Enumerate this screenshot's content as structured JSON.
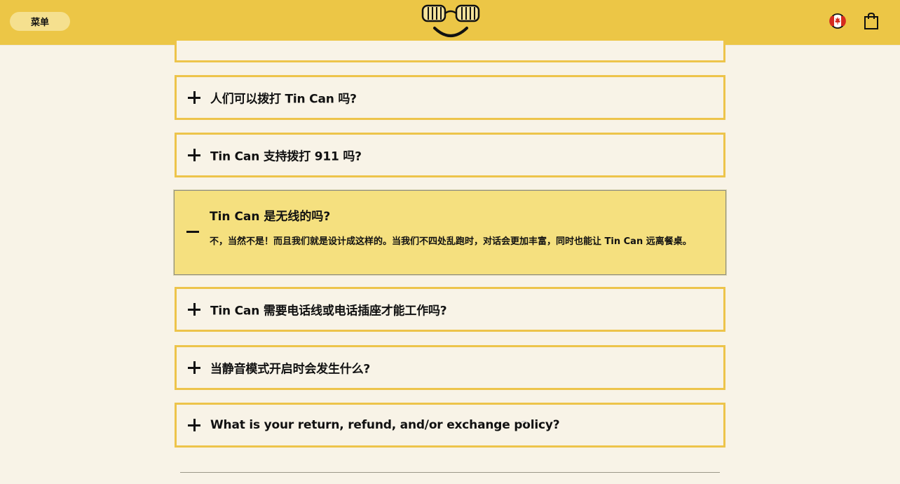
{
  "header": {
    "menu_label": "菜单",
    "flag_icon": "canada-flag-icon",
    "cart_icon": "shopping-bag-icon",
    "brand_color": "#ecc646"
  },
  "faq": {
    "items": [
      {
        "question": "人们可以拨打 Tin Can 吗?",
        "expanded": false
      },
      {
        "question": "Tin Can 支持拨打 911 吗?",
        "expanded": false
      },
      {
        "question": "Tin Can 是无线的吗?",
        "expanded": true,
        "answer": "不，当然不是！而且我们就是设计成这样的。当我们不四处乱跑时，对话会更加丰富，同时也能让 Tin Can 远离餐桌。"
      },
      {
        "question": "Tin Can 需要电话线或电话插座才能工作吗?",
        "expanded": false
      },
      {
        "question": "当静音模式开启时会发生什么?",
        "expanded": false
      },
      {
        "question": "What is your return, refund, and/or exchange policy?",
        "expanded": false
      }
    ]
  },
  "colors": {
    "page_bg": "#f8f3e7",
    "border": "#edc44b",
    "expanded_bg": "#f5e07f"
  }
}
